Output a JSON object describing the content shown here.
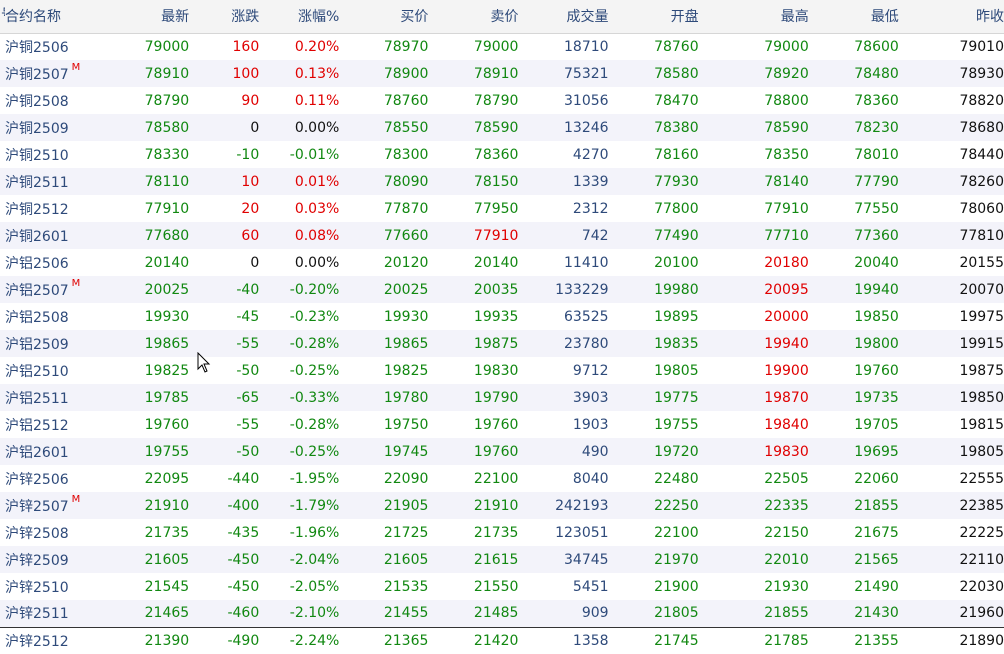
{
  "columns": {
    "edge_glyph": "号",
    "name": "合约名称",
    "last": "最新",
    "change": "涨跌",
    "change_pct": "涨幅%",
    "bid": "买价",
    "ask": "卖价",
    "volume": "成交量",
    "open": "开盘",
    "high": "最高",
    "low": "最低",
    "prev_close": "昨收"
  },
  "colors": {
    "up": "#e00000",
    "down": "#118811",
    "flat": "#111111",
    "label": "#2e4a7a"
  },
  "rows": [
    {
      "name": "沪铜2506",
      "main": "",
      "last": "79000",
      "change": "160",
      "change_pct": "0.20%",
      "bid": "78970",
      "ask": "79000",
      "volume": "18710",
      "open": "78760",
      "high": "79000",
      "low": "78600",
      "prev_close": "79010"
    },
    {
      "name": "沪铜2507",
      "main": "M",
      "last": "78910",
      "change": "100",
      "change_pct": "0.13%",
      "bid": "78900",
      "ask": "78910",
      "volume": "75321",
      "open": "78580",
      "high": "78920",
      "low": "78480",
      "prev_close": "78930"
    },
    {
      "name": "沪铜2508",
      "main": "",
      "last": "78790",
      "change": "90",
      "change_pct": "0.11%",
      "bid": "78760",
      "ask": "78790",
      "volume": "31056",
      "open": "78470",
      "high": "78800",
      "low": "78360",
      "prev_close": "78820"
    },
    {
      "name": "沪铜2509",
      "main": "",
      "last": "78580",
      "change": "0",
      "change_pct": "0.00%",
      "bid": "78550",
      "ask": "78590",
      "volume": "13246",
      "open": "78380",
      "high": "78590",
      "low": "78230",
      "prev_close": "78680"
    },
    {
      "name": "沪铜2510",
      "main": "",
      "last": "78330",
      "change": "-10",
      "change_pct": "-0.01%",
      "bid": "78300",
      "ask": "78360",
      "volume": "4270",
      "open": "78160",
      "high": "78350",
      "low": "78010",
      "prev_close": "78440"
    },
    {
      "name": "沪铜2511",
      "main": "",
      "last": "78110",
      "change": "10",
      "change_pct": "0.01%",
      "bid": "78090",
      "ask": "78150",
      "volume": "1339",
      "open": "77930",
      "high": "78140",
      "low": "77790",
      "prev_close": "78260"
    },
    {
      "name": "沪铜2512",
      "main": "",
      "last": "77910",
      "change": "20",
      "change_pct": "0.03%",
      "bid": "77870",
      "ask": "77950",
      "volume": "2312",
      "open": "77800",
      "high": "77910",
      "low": "77550",
      "prev_close": "78060"
    },
    {
      "name": "沪铜2601",
      "main": "",
      "last": "77680",
      "change": "60",
      "change_pct": "0.08%",
      "bid": "77660",
      "ask": "77910",
      "volume": "742",
      "open": "77490",
      "high": "77710",
      "low": "77360",
      "prev_close": "77810"
    },
    {
      "name": "沪铝2506",
      "main": "",
      "last": "20140",
      "change": "0",
      "change_pct": "0.00%",
      "bid": "20120",
      "ask": "20140",
      "volume": "11410",
      "open": "20100",
      "high": "20180",
      "low": "20040",
      "prev_close": "20155"
    },
    {
      "name": "沪铝2507",
      "main": "M",
      "last": "20025",
      "change": "-40",
      "change_pct": "-0.20%",
      "bid": "20025",
      "ask": "20035",
      "volume": "133229",
      "open": "19980",
      "high": "20095",
      "low": "19940",
      "prev_close": "20070"
    },
    {
      "name": "沪铝2508",
      "main": "",
      "last": "19930",
      "change": "-45",
      "change_pct": "-0.23%",
      "bid": "19930",
      "ask": "19935",
      "volume": "63525",
      "open": "19895",
      "high": "20000",
      "low": "19850",
      "prev_close": "19975"
    },
    {
      "name": "沪铝2509",
      "main": "",
      "last": "19865",
      "change": "-55",
      "change_pct": "-0.28%",
      "bid": "19865",
      "ask": "19875",
      "volume": "23780",
      "open": "19835",
      "high": "19940",
      "low": "19800",
      "prev_close": "19915"
    },
    {
      "name": "沪铝2510",
      "main": "",
      "last": "19825",
      "change": "-50",
      "change_pct": "-0.25%",
      "bid": "19825",
      "ask": "19830",
      "volume": "9712",
      "open": "19805",
      "high": "19900",
      "low": "19760",
      "prev_close": "19875"
    },
    {
      "name": "沪铝2511",
      "main": "",
      "last": "19785",
      "change": "-65",
      "change_pct": "-0.33%",
      "bid": "19780",
      "ask": "19790",
      "volume": "3903",
      "open": "19775",
      "high": "19870",
      "low": "19735",
      "prev_close": "19850"
    },
    {
      "name": "沪铝2512",
      "main": "",
      "last": "19760",
      "change": "-55",
      "change_pct": "-0.28%",
      "bid": "19750",
      "ask": "19760",
      "volume": "1903",
      "open": "19755",
      "high": "19840",
      "low": "19705",
      "prev_close": "19815"
    },
    {
      "name": "沪铝2601",
      "main": "",
      "last": "19755",
      "change": "-50",
      "change_pct": "-0.25%",
      "bid": "19745",
      "ask": "19760",
      "volume": "490",
      "open": "19720",
      "high": "19830",
      "low": "19695",
      "prev_close": "19805"
    },
    {
      "name": "沪锌2506",
      "main": "",
      "last": "22095",
      "change": "-440",
      "change_pct": "-1.95%",
      "bid": "22090",
      "ask": "22100",
      "volume": "8040",
      "open": "22480",
      "high": "22505",
      "low": "22060",
      "prev_close": "22555"
    },
    {
      "name": "沪锌2507",
      "main": "M",
      "last": "21910",
      "change": "-400",
      "change_pct": "-1.79%",
      "bid": "21905",
      "ask": "21910",
      "volume": "242193",
      "open": "22250",
      "high": "22335",
      "low": "21855",
      "prev_close": "22385"
    },
    {
      "name": "沪锌2508",
      "main": "",
      "last": "21735",
      "change": "-435",
      "change_pct": "-1.96%",
      "bid": "21725",
      "ask": "21735",
      "volume": "123051",
      "open": "22100",
      "high": "22150",
      "low": "21675",
      "prev_close": "22225"
    },
    {
      "name": "沪锌2509",
      "main": "",
      "last": "21605",
      "change": "-450",
      "change_pct": "-2.04%",
      "bid": "21605",
      "ask": "21615",
      "volume": "34745",
      "open": "21970",
      "high": "22010",
      "low": "21565",
      "prev_close": "22110"
    },
    {
      "name": "沪锌2510",
      "main": "",
      "last": "21545",
      "change": "-450",
      "change_pct": "-2.05%",
      "bid": "21535",
      "ask": "21550",
      "volume": "5451",
      "open": "21900",
      "high": "21930",
      "low": "21490",
      "prev_close": "22030"
    },
    {
      "name": "沪锌2511",
      "main": "",
      "last": "21465",
      "change": "-460",
      "change_pct": "-2.10%",
      "bid": "21455",
      "ask": "21485",
      "volume": "909",
      "open": "21805",
      "high": "21855",
      "low": "21430",
      "prev_close": "21960"
    },
    {
      "name": "沪锌2512",
      "main": "",
      "last": "21390",
      "change": "-490",
      "change_pct": "-2.24%",
      "bid": "21365",
      "ask": "21420",
      "volume": "1358",
      "open": "21745",
      "high": "21785",
      "low": "21355",
      "prev_close": "21890"
    }
  ]
}
